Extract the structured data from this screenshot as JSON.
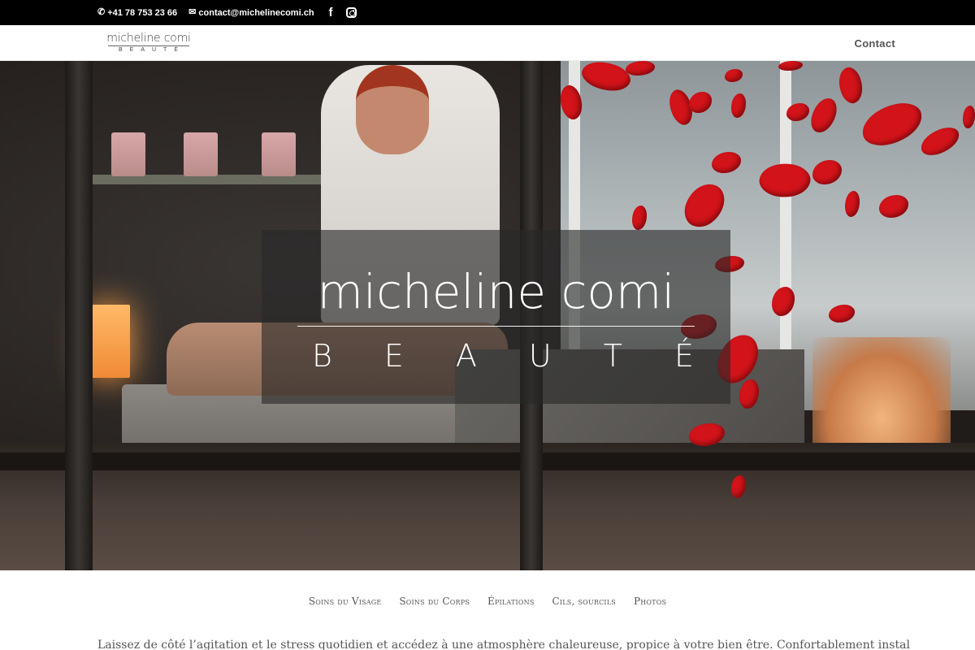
{
  "topbar": {
    "phone": "+41 78 753 23 66",
    "email": "contact@michelinecomi.ch",
    "icons": [
      "phone-icon",
      "envelope-icon",
      "facebook-icon",
      "instagram-icon"
    ]
  },
  "header": {
    "logo_name": "micheline comi",
    "logo_sub": "BEAUTÉ",
    "nav": {
      "contact": "Contact"
    }
  },
  "hero": {
    "title": "micheline comi",
    "subtitle_letters": [
      "B",
      "E",
      "A",
      "U",
      "T",
      "É"
    ]
  },
  "subnav": {
    "items": [
      "Soins du Visage",
      "Soins du Corps",
      "Épilations",
      "Cils, sourcils",
      "Photos"
    ]
  },
  "intro": {
    "text": "Laissez de côté l’agitation et le stress quotidien et accédez à une atmosphère chaleureuse, propice à votre bien être. Confortablement installé,"
  },
  "colors": {
    "topbar_bg": "#000000",
    "petal_red": "#d2141a",
    "nav_text": "#555555"
  }
}
